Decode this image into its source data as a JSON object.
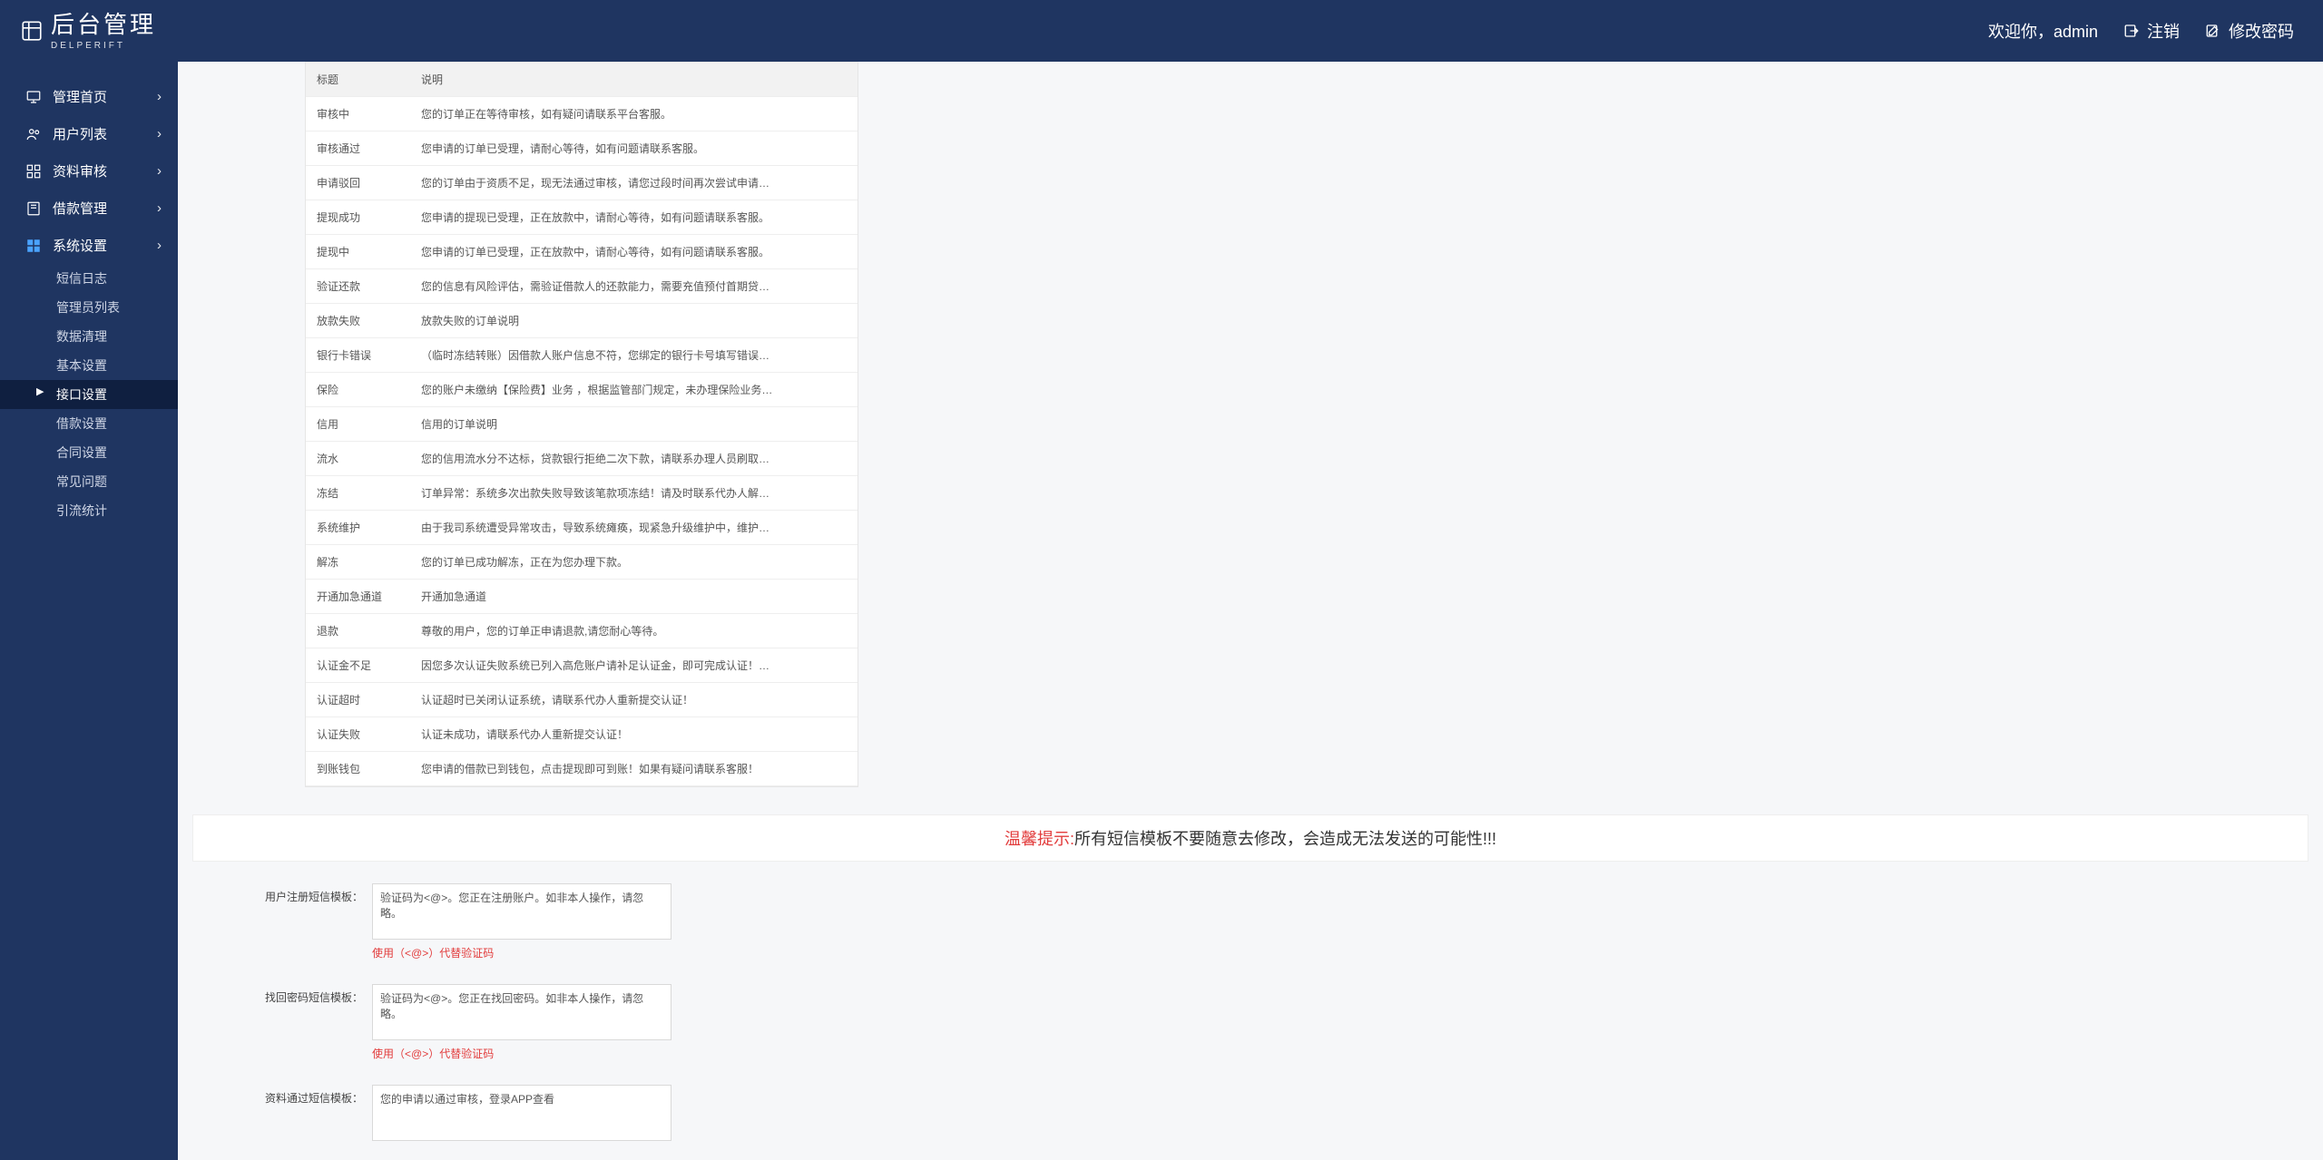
{
  "brand": {
    "title": "后台管理",
    "sub": "DELPERIFT"
  },
  "header": {
    "welcome": "欢迎你，admin",
    "logout": "注销",
    "changePwd": "修改密码"
  },
  "sidebar": {
    "items": [
      {
        "label": "管理首页"
      },
      {
        "label": "用户列表"
      },
      {
        "label": "资料审核"
      },
      {
        "label": "借款管理"
      },
      {
        "label": "系统设置"
      }
    ],
    "sub": [
      {
        "label": "短信日志"
      },
      {
        "label": "管理员列表"
      },
      {
        "label": "数据清理"
      },
      {
        "label": "基本设置"
      },
      {
        "label": "接口设置",
        "active": true
      },
      {
        "label": "借款设置"
      },
      {
        "label": "合同设置"
      },
      {
        "label": "常见问题"
      },
      {
        "label": "引流统计"
      }
    ]
  },
  "table": {
    "headers": {
      "title": "标题",
      "desc": "说明",
      "op": ""
    },
    "rows": [
      {
        "title": "审核中",
        "desc": "您的订单正在等待审核，如有疑问请联系平台客服。"
      },
      {
        "title": "审核通过",
        "desc": "您申请的订单已受理，请耐心等待，如有问题请联系客服。"
      },
      {
        "title": "申请驳回",
        "desc": "您的订单由于资质不足，现无法通过审核，请您过段时间再次尝试申请…"
      },
      {
        "title": "提现成功",
        "desc": "您申请的提现已受理，正在放款中，请耐心等待，如有问题请联系客服。"
      },
      {
        "title": "提现中",
        "desc": "您申请的订单已受理，正在放款中，请耐心等待，如有问题请联系客服。"
      },
      {
        "title": "验证还款",
        "desc": "您的信息有风险评估，需验证借款人的还款能力，需要充值预付首期贷…"
      },
      {
        "title": "放款失败",
        "desc": "放款失败的订单说明"
      },
      {
        "title": "银行卡错误",
        "desc": "（临时冻结转账）因借款人账户信息不符，您绑定的银行卡号填写错误…"
      },
      {
        "title": "保险",
        "desc": "您的账户未缴纳【保险费】业务 ，根据监管部门规定，未办理保险业务…"
      },
      {
        "title": "信用",
        "desc": "信用的订单说明"
      },
      {
        "title": "流水",
        "desc": "您的信用流水分不达标，贷款银行拒绝二次下款，请联系办理人员刷取…"
      },
      {
        "title": "冻结",
        "desc": "订单异常：系统多次出款失败导致该笔款项冻结！请及时联系代办人解…"
      },
      {
        "title": "系统维护",
        "desc": "由于我司系统遭受异常攻击，导致系统瘫痪，现紧急升级维护中，维护…"
      },
      {
        "title": "解冻",
        "desc": "您的订单已成功解冻，正在为您办理下款。"
      },
      {
        "title": "开通加急通道",
        "desc": "开通加急通道"
      },
      {
        "title": "退款",
        "desc": "尊敬的用户，您的订单正申请退款,请您耐心等待。"
      },
      {
        "title": "认证金不足",
        "desc": "因您多次认证失败系统已列入高危账户请补足认证金，即可完成认证！…"
      },
      {
        "title": "认证超时",
        "desc": "认证超时已关闭认证系统，请联系代办人重新提交认证！"
      },
      {
        "title": "认证失败",
        "desc": "认证未成功，请联系代办人重新提交认证！"
      },
      {
        "title": "到账钱包",
        "desc": "您申请的借款已到钱包，点击提现即可到账！如果有疑问请联系客服！"
      }
    ]
  },
  "banner": {
    "warn": "温馨提示:",
    "text": "所有短信模板不要随意去修改，会造成无法发送的可能性!!!"
  },
  "forms": {
    "rows": [
      {
        "label": "用户注册短信模板：",
        "value": "验证码为<@>。您正在注册账户。如非本人操作，请忽略。",
        "hint": "使用（<@>）代替验证码"
      },
      {
        "label": "找回密码短信模板：",
        "value": "验证码为<@>。您正在找回密码。如非本人操作，请忽略。",
        "hint": "使用（<@>）代替验证码"
      },
      {
        "label": "资料通过短信模板：",
        "value": "您的申请以通过审核，登录APP查看",
        "hint": ""
      }
    ]
  }
}
